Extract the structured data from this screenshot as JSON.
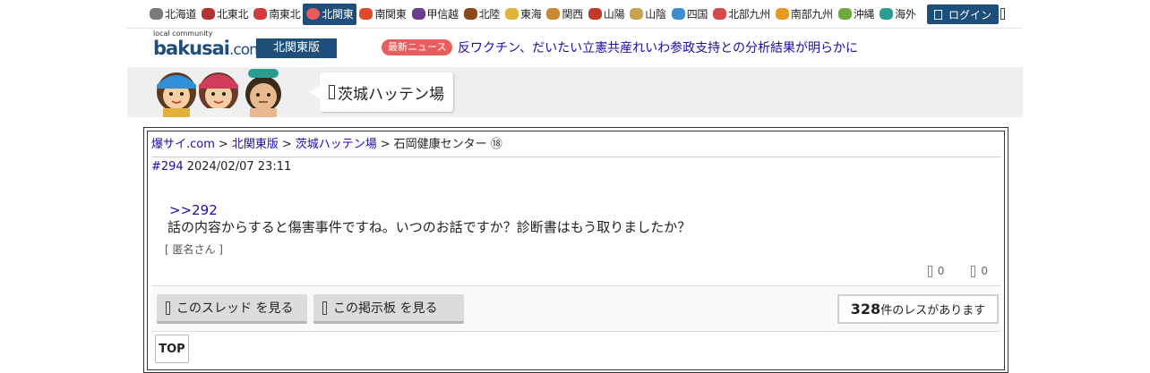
{
  "regions": [
    {
      "label": "北海道",
      "icon": "hokkaido-icon",
      "color": "#7a7a7a"
    },
    {
      "label": "北東北",
      "icon": "tohoku-north-icon",
      "color": "#b5332f"
    },
    {
      "label": "南東北",
      "icon": "tohoku-south-icon",
      "color": "#d23c3c"
    },
    {
      "label": "北関東",
      "icon": "kanto-north-icon",
      "color": "#e95b5b"
    },
    {
      "label": "南関東",
      "icon": "tokyo-tower-icon",
      "color": "#e04a2a"
    },
    {
      "label": "甲信越",
      "icon": "grape-icon",
      "color": "#6a3c8c"
    },
    {
      "label": "北陸",
      "icon": "gate-icon",
      "color": "#8b4a1c"
    },
    {
      "label": "東海",
      "icon": "shachi-icon",
      "color": "#e2b33a"
    },
    {
      "label": "関西",
      "icon": "takoyaki-icon",
      "color": "#c98a2f"
    },
    {
      "label": "山陽",
      "icon": "shrine-icon",
      "color": "#c0392b"
    },
    {
      "label": "山陰",
      "icon": "camel-icon",
      "color": "#c8a24c"
    },
    {
      "label": "四国",
      "icon": "udon-icon",
      "color": "#3a8ed0"
    },
    {
      "label": "北部九州",
      "icon": "mentaiko-icon",
      "color": "#d74a4a"
    },
    {
      "label": "南部九州",
      "icon": "mango-icon",
      "color": "#e79a1d"
    },
    {
      "label": "沖縄",
      "icon": "shisa-icon",
      "color": "#6fa83b"
    },
    {
      "label": "海外",
      "icon": "globe-icon",
      "color": "#2a9d8f"
    }
  ],
  "active_region_index": 3,
  "login_label": "ログイン",
  "logo": {
    "small": "local community",
    "main": "bakusai",
    "dot": ".com"
  },
  "edition": "北関東版",
  "news": {
    "badge": "最新ニュース",
    "headline": "反ワクチン、だいたい立憲共産れいわ参政支持との分析結果が明らかに"
  },
  "board_title": "茨城ハッテン場",
  "breadcrumb": [
    "爆サイ.com",
    "北関東版",
    "茨城ハッテン場",
    "石岡健康センター ⑱"
  ],
  "post": {
    "number": "#294",
    "date": "2024/02/07 23:11",
    "reply_to": ">>292",
    "body": "話の内容からすると傷害事件ですね。いつのお話ですか？診断書はもう取りましたか？",
    "author": "[ 匿名さん ]",
    "likes": "0",
    "dislikes": "0"
  },
  "buttons": {
    "thread": "このスレッド を見る",
    "board": "この掲示板 を見る"
  },
  "res_count": {
    "number": "328",
    "suffix": "件のレスがあります"
  },
  "top_label": "TOP",
  "colors": {
    "brand": "#1d4f7a",
    "news_badge": "#e85d5d",
    "link": "#1a0dab",
    "banner_bg": "#efefef"
  }
}
